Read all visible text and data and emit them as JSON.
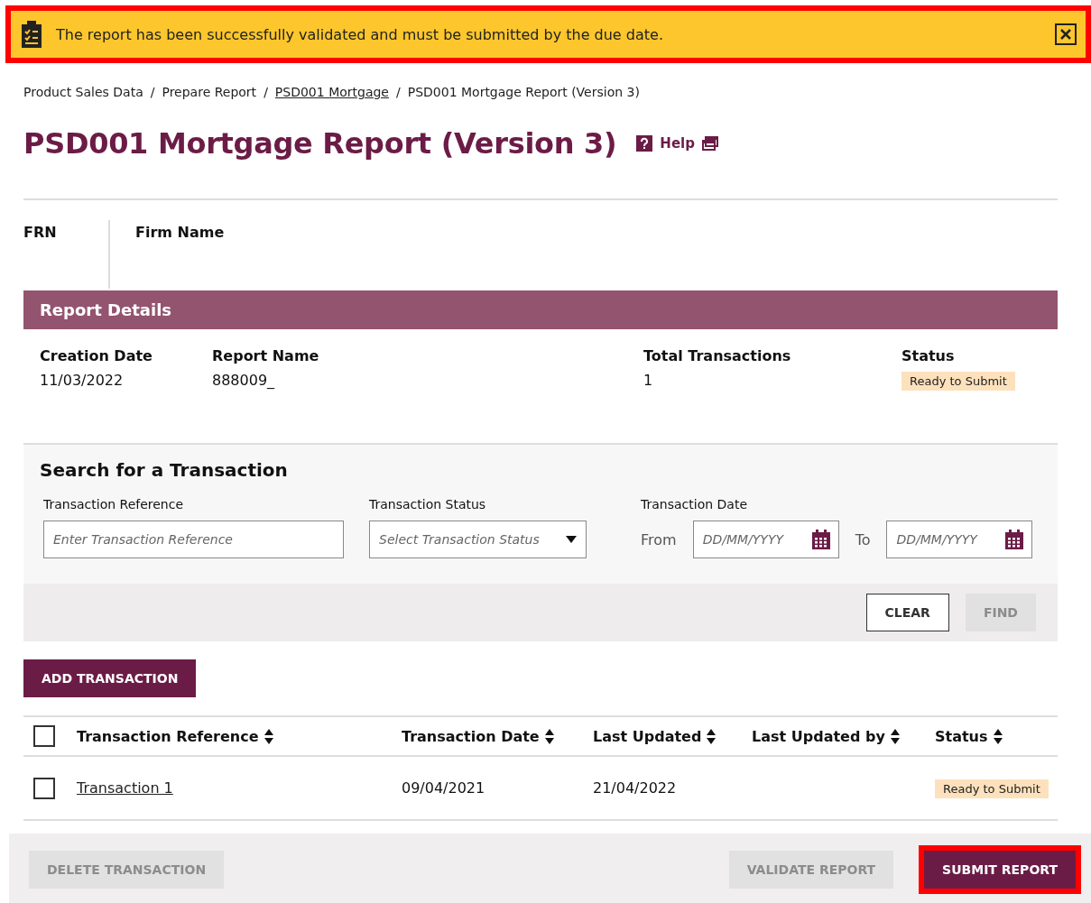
{
  "alert": {
    "message": "The report has been successfully validated and must be submitted by the due date.",
    "highlighted": true
  },
  "breadcrumb": [
    {
      "label": "Product Sales Data",
      "link": false
    },
    {
      "separator": "/",
      "label": "Prepare Report",
      "link": false
    },
    {
      "separator": "/",
      "label": "PSD001 Mortgage",
      "link": true
    },
    {
      "separator": "/",
      "label": "PSD001 Mortgage Report (Version 3)",
      "link": false
    }
  ],
  "title": "PSD001 Mortgage Report (Version 3)",
  "help": "Help",
  "firm": [
    {
      "label": "FRN"
    },
    {
      "label": "Firm Name"
    }
  ],
  "report_details": {
    "heading": "Report Details",
    "fields": [
      {
        "label": "Creation Date",
        "value": "11/03/2022",
        "kind": "text"
      },
      {
        "label": "Report Name",
        "value": "888009_",
        "kind": "text"
      },
      {
        "label": "Total Transactions",
        "value": "1",
        "kind": "text"
      },
      {
        "label": "Status",
        "value": "Ready to Submit",
        "kind": "badge"
      }
    ]
  },
  "search": {
    "heading": "Search for a Transaction",
    "reference": {
      "label": "Transaction Reference",
      "placeholder": "Enter Transaction Reference"
    },
    "status": {
      "label": "Transaction Status",
      "placeholder": "Select Transaction Status"
    },
    "date": {
      "label": "Transaction Date",
      "from": "From",
      "to": "To",
      "from_placeholder": "DD/MM/YYYY",
      "to_placeholder": "DD/MM/YYYY"
    },
    "buttons": [
      {
        "label": "CLEAR",
        "disabled": false
      },
      {
        "label": "FIND",
        "disabled": true
      }
    ]
  },
  "add_button": "ADD TRANSACTION",
  "table": {
    "columns": [
      "Transaction Reference",
      "Transaction Date",
      "Last Updated",
      "Last Updated by",
      "Status"
    ],
    "header_checked": false,
    "rows": [
      {
        "checked": false,
        "reference": "Transaction 1",
        "date": "09/04/2021",
        "updated": "21/04/2022",
        "status": "Ready to Submit"
      }
    ]
  },
  "footer_buttons": [
    {
      "label": "DELETE TRANSACTION",
      "disabled": true,
      "highlighted": false
    },
    {
      "label": "VALIDATE REPORT",
      "disabled": true,
      "highlighted": false
    },
    {
      "label": "SUBMIT REPORT",
      "disabled": false,
      "highlighted": true
    }
  ]
}
